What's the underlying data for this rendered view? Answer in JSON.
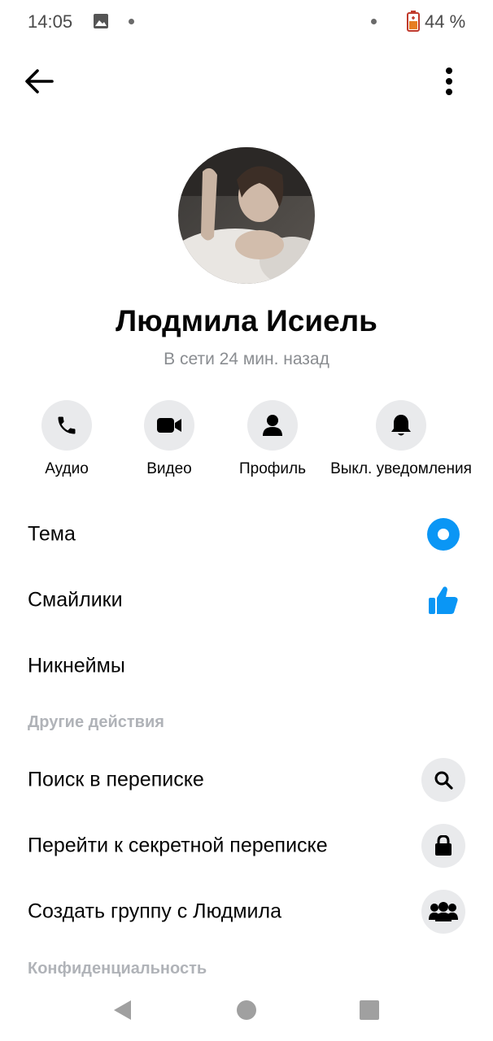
{
  "status_bar": {
    "time": "14:05",
    "battery": "44 %",
    "icons": [
      "gallery-icon",
      "battery-saver-icon"
    ]
  },
  "top_bar": {
    "back_icon": "arrow-left-icon",
    "more_icon": "more-vertical-icon"
  },
  "profile": {
    "name": "Людмила Исиель",
    "presence": "В сети 24 мин. назад"
  },
  "actions": [
    {
      "label": "Аудио",
      "icon": "phone-icon"
    },
    {
      "label": "Видео",
      "icon": "video-icon"
    },
    {
      "label": "Профиль",
      "icon": "person-icon"
    },
    {
      "label": "Выкл. уведомления",
      "icon": "bell-icon"
    }
  ],
  "settings": {
    "theme": "Тема",
    "emoji": "Смайлики",
    "nicknames": "Никнеймы"
  },
  "sections": {
    "other_actions": "Другие действия",
    "privacy": "Конфиденциальность"
  },
  "other_actions": {
    "search": "Поиск в переписке",
    "secret": "Перейти к секретной переписке",
    "create_group": "Создать группу с Людмила"
  },
  "colors": {
    "accent": "#0a96f5",
    "muted": "#8a8d91",
    "circle_bg": "#e9eaec"
  }
}
